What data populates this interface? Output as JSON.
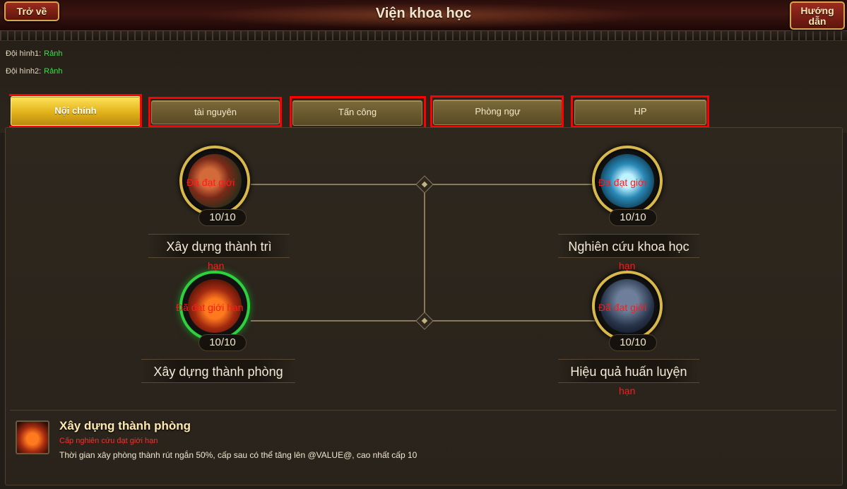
{
  "header": {
    "title": "Viện khoa học",
    "back_label": "Trở về",
    "guide_label": "Hướng dẫn"
  },
  "teams": [
    {
      "label": "Đội hình1:",
      "status": "Rảnh"
    },
    {
      "label": "Đội hình2:",
      "status": "Rảnh"
    }
  ],
  "tabs": [
    {
      "label": "Nội chính",
      "active": true
    },
    {
      "label": "tài nguyên",
      "active": false
    },
    {
      "label": "Tấn công",
      "active": false
    },
    {
      "label": "Phòng ngự",
      "active": false
    },
    {
      "label": "HP",
      "active": false
    }
  ],
  "skills": [
    {
      "name": "Xây dựng thành trì",
      "level": "10/10",
      "limit_line1": "Đã đạt giới",
      "limit_line2": "hạn",
      "icon": "castle-icon"
    },
    {
      "name": "Nghiên cứu khoa học",
      "level": "10/10",
      "limit_line1": "Đã đạt giới",
      "limit_line2": "hạn",
      "icon": "bagua-icon"
    },
    {
      "name": "Xây dựng thành phòng",
      "level": "10/10",
      "limit_line1": "Đã đạt giới hạn",
      "limit_line2": "",
      "icon": "fire-logs-icon"
    },
    {
      "name": "Hiệu quả huấn luyện",
      "level": "10/10",
      "limit_line1": "Đã đạt giới",
      "limit_line2": "hạn",
      "icon": "soldier-icon"
    }
  ],
  "info": {
    "name": "Xây dựng thành phòng",
    "status": "Cấp nghiên cứu đạt giới hạn",
    "description": "Thời gian xây phòng thành rút ngắn 50%, cấp sau có thể tăng lên @VALUE@, cao nhất cấp 10"
  },
  "colors": {
    "status_free": "#38e24a",
    "limit_red": "#ff1a1a",
    "tab_active": "#e2b21a",
    "highlight_frame": "#ff0000"
  }
}
